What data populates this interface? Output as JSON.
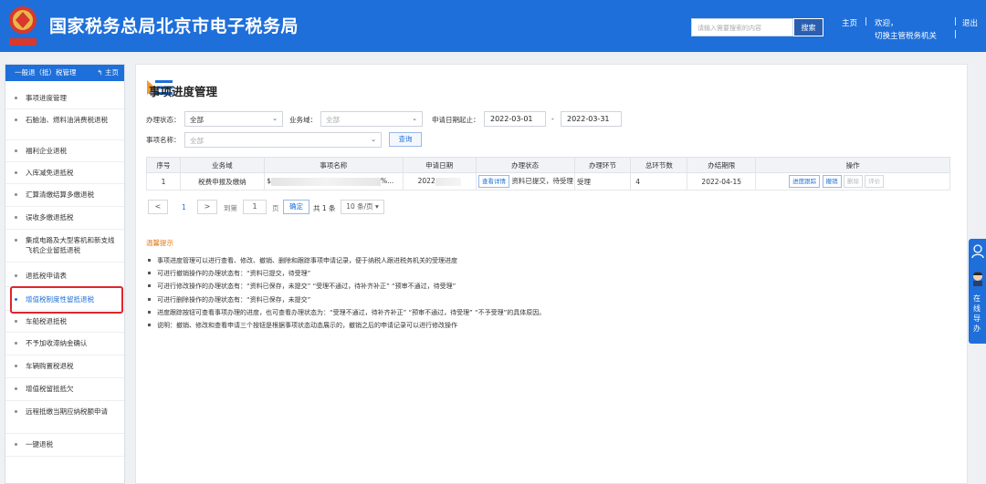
{
  "header": {
    "title": "国家税务总局北京市电子税务局",
    "search_placeholder": "请输入需要搜索的内容",
    "search_button": "搜索",
    "home_link": "主页",
    "welcome": "欢迎，",
    "switch_org": "切换主管税务机关",
    "logout": "退出"
  },
  "sidebar": {
    "head_label": "一般退（抵）税管理",
    "home_label": "主页",
    "items": [
      {
        "label": "事项进度管理"
      },
      {
        "label": "石脑油、燃料油消费税退税"
      },
      {
        "label": "福利企业退税"
      },
      {
        "label": "入库减免退抵税"
      },
      {
        "label": "汇算清缴结算多缴退税"
      },
      {
        "label": "误收多缴退抵税"
      },
      {
        "label": "集成电路及大型客机和新支线飞机企业留抵退税"
      },
      {
        "label": "退抵税申请表"
      },
      {
        "label": "增值税制度性留抵退税"
      },
      {
        "label": "车船税退抵税"
      },
      {
        "label": "不予加收滞纳金确认"
      },
      {
        "label": "车辆购置税退税"
      },
      {
        "label": "增值税留抵抵欠"
      },
      {
        "label": "远程抵缴当期应纳税额申请"
      },
      {
        "label": "一键退税"
      }
    ]
  },
  "main": {
    "page_title": "事项进度管理",
    "filters": {
      "status_label": "办理状态：",
      "status_value": "全部",
      "business_label": "业务域：",
      "business_value": "全部",
      "date_label": "申请日期起止：",
      "date_from": "2022-03-01",
      "date_sep": "-",
      "date_to": "2022-03-31",
      "name_label": "事项名称：",
      "name_value": "全部",
      "query_button": "查询"
    },
    "table": {
      "headers": [
        "序号",
        "业务域",
        "事项名称",
        "申请日期",
        "办理状态",
        "办理环节",
        "总环节数",
        "办结期限",
        "操作"
      ],
      "rows": [
        {
          "index": "1",
          "business": "税费申报及缴纳",
          "name_prefix": "$",
          "name_suffix": "%...",
          "date": "2022",
          "view_detail": "查看详情",
          "status": "资料已提交，待受理",
          "step": "受理",
          "total_steps": "4",
          "deadline": "2022-04-15",
          "actions": [
            "进度跟踪",
            "撤销",
            "删除",
            "评价"
          ]
        }
      ]
    },
    "pager": {
      "prev": "<",
      "current_page": "1",
      "next": ">",
      "goto_label": "到第",
      "goto_value": "1",
      "page_unit": "页",
      "confirm": "确定",
      "total": "共 1 条",
      "page_size": "10 条/页"
    },
    "tips": {
      "title": "温馨提示",
      "lines": [
        "事项进度管理可以进行查看、修改、撤销、删除和跟踪事项申请记录，便于纳税人跟进税务机关的受理进度",
        "可进行撤销操作的办理状态有：“资料已提交，待受理”",
        "可进行修改操作的办理状态有：“资料已保存，未提交” “受理不通过，待补齐补正” “预审不通过，待受理”",
        "可进行删除操作的办理状态有：“资料已保存，未提交”",
        "进度跟踪按钮可查看事项办理的进度，也可查看办理状态为：“受理不通过，待补齐补正” “预审不通过，待受理” “不予受理”的具体原因。",
        "说明：撤销、修改和查看申请三个按钮是根据事项状态动态展示的，撤销之后的申请记录可以进行修改操作"
      ]
    }
  },
  "float_panel": {
    "label": "在线导办"
  },
  "colors": {
    "brand_blue": "#1e6fd9",
    "highlight_red": "#e0252b",
    "tips_orange": "#e07b18"
  }
}
